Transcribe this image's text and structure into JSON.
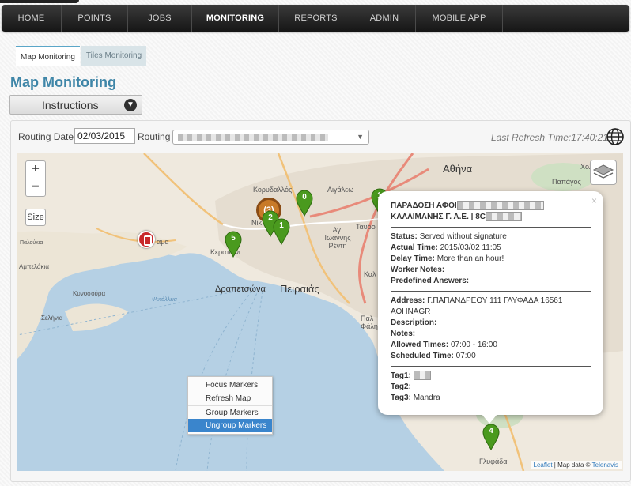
{
  "nav": {
    "items": [
      {
        "label": "HOME"
      },
      {
        "label": "POINTS"
      },
      {
        "label": "JOBS"
      },
      {
        "label": "MONITORING",
        "active": true
      },
      {
        "label": "REPORTS"
      },
      {
        "label": "ADMIN"
      },
      {
        "label": "MOBILE APP"
      }
    ]
  },
  "subtabs": [
    {
      "label": "Map Monitoring",
      "active": true
    },
    {
      "label": "Tiles Monitoring"
    }
  ],
  "page": {
    "title": "Map Monitoring",
    "instructions_label": "Instructions"
  },
  "controls": {
    "routing_date_label": "Routing Date",
    "routing_date_value": "02/03/2015",
    "routing_label": "Routing",
    "last_refresh": "Last Refresh Time:17:40:21"
  },
  "map": {
    "zoom_in": "+",
    "zoom_out": "−",
    "size_label": "Size",
    "labels": {
      "athina": "Αθήνα",
      "cholargos": "Χολαργ",
      "papagos": "Παπάγος",
      "korydallos": "Κορυδαλλός",
      "aigaleo": "Αιγάλεω",
      "nikaia": "Νίκ",
      "agios_ioannis_renti": "Αγ. Ιωάννης Ρέντη",
      "tavros": "Ταυρο",
      "keratsini": "Κερατσίνι",
      "drapetsona": "Δραπετσώνα",
      "peiraias": "Πειραιάς",
      "salamina": "αμα",
      "paloukia": "Παλούκια",
      "ampelakia": "Αμπελάκια",
      "kynosoura": "Κυνοσούρα",
      "selinia": "Σελήνια",
      "psitalleia": "Ψυτάλλεια",
      "glyfada": "Γλυφάδα",
      "kal": "Καλ",
      "palaio_faliro": "Παλ Φάλη"
    },
    "markers": [
      {
        "type": "cluster",
        "label": "(3)"
      },
      {
        "type": "pin",
        "label": "0"
      },
      {
        "type": "pin",
        "label": "1"
      },
      {
        "type": "pin",
        "label": "2"
      },
      {
        "type": "pin",
        "label": "1"
      },
      {
        "type": "pin",
        "label": "5"
      },
      {
        "type": "pin",
        "label": "4"
      },
      {
        "type": "alert",
        "label": ""
      }
    ],
    "attribution": {
      "leaflet": "Leaflet",
      "text": " | Map data © ",
      "provider": "Telenavis"
    },
    "colors": {
      "pin_green": "#4a9a1e",
      "cluster_orange": "#c87a28",
      "alert_red": "#c8282a",
      "sea": "#b5d0e4",
      "land": "#efe9de"
    }
  },
  "popup": {
    "title_line1": "ΠΑΡΑΔΟΣΗ ΑΦΟΙ",
    "title_line2": "ΚΑΛΛΙΜΑΝΗΣ Γ. Α.Ε. | 8C",
    "status_label": "Status:",
    "status_value": "Served without signature",
    "actual_time_label": "Actual Time:",
    "actual_time_value": "2015/03/02 11:05",
    "delay_time_label": "Delay Time:",
    "delay_time_value": "More than an hour!",
    "worker_notes_label": "Worker Notes:",
    "predefined_answers_label": "Predefined Answers:",
    "address_label": "Address:",
    "address_value": "Γ.ΠΑΠΑΝΔΡΕΟΥ 111 ΓΛΥΦΑΔΑ 16561",
    "address_line2": "ΑΘΗΝΑGR",
    "description_label": "Description:",
    "notes_label": "Notes:",
    "allowed_times_label": "Allowed Times:",
    "allowed_times_value": "07:00 - 16:00",
    "scheduled_time_label": "Scheduled Time:",
    "scheduled_time_value": "07:00",
    "tag1_label": "Tag1:",
    "tag2_label": "Tag2:",
    "tag3_label": "Tag3:",
    "tag3_value": "Mandra",
    "close": "×"
  },
  "context_menu": [
    {
      "label": "Focus Markers"
    },
    {
      "label": "Refresh Map"
    },
    {
      "label": "Group Markers"
    },
    {
      "label": "Ungroup Markers",
      "highlighted": true
    }
  ]
}
